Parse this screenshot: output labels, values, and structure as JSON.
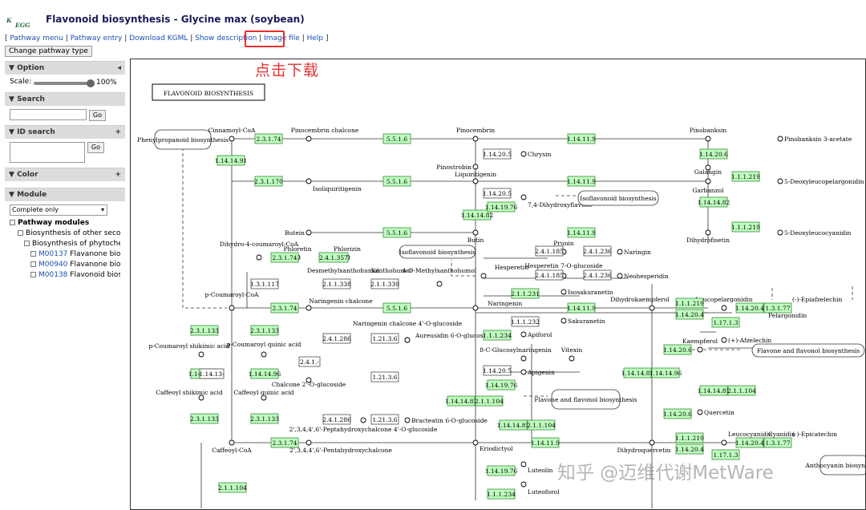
{
  "header": {
    "logo": "KEGG",
    "title": "Flavonoid biosynthesis - Glycine max (soybean)",
    "links": [
      "Pathway menu",
      "Pathway entry",
      "Download KGML",
      "Show description",
      "Image file",
      "Help"
    ],
    "change_type": "Change pathway type",
    "annotation": "点击下载",
    "highlight_color": "#e53030"
  },
  "sidebar": {
    "option": {
      "label": "Option",
      "scale_label": "Scale:",
      "scale_value": "100%",
      "scale_fraction": 1.0
    },
    "search": {
      "label": "Search",
      "go": "Go"
    },
    "id_search": {
      "label": "ID search",
      "go": "Go"
    },
    "color": {
      "label": "Color"
    },
    "module": {
      "label": "Module",
      "select": "Complete only",
      "tree": [
        "Pathway modules",
        "Biosynthesis of other secondary metabolites",
        "Biosynthesis of phytochemical compounds"
      ],
      "items": [
        {
          "id": "M00137",
          "name": "Flavanone biosynthesis"
        },
        {
          "id": "M00940",
          "name": "Flavanone biosynthesis"
        },
        {
          "id": "M00138",
          "name": "Flavonoid biosynthesis"
        }
      ]
    }
  },
  "map": {
    "title": "FLAVONOID BIOSYNTHESIS",
    "enzyme_fill": "#bfffbf",
    "enzyme_stroke": "#3a8a3a",
    "enzymes": [
      "2.3.1.74",
      "5.5.1.6",
      "1.14.11.9",
      "1.14.14.91",
      "2.3.1.170",
      "1.14.20.5",
      "1.14.19.76",
      "1.14.14.82",
      "1.14.20.6",
      "1.1.1.219",
      "2.3.1.133",
      "1.14.13-",
      "1.14.14.96",
      "1.14.14.81",
      "2.1.1.104",
      "2.4.1.185",
      "2.4.1.236",
      "2.1.1.231",
      "1.1.1.232",
      "1.1.1.234",
      "2.4.1.286",
      "1.21.3.6",
      "1.17.1.3",
      "1.3.1.77",
      "1.14.20.4",
      "2.1.1.338",
      "2.1.1.339",
      "1.3.1.117",
      "2.4.1.357",
      "2.4.1.-"
    ],
    "compounds": [
      "Cinnamoyl-CoA",
      "Pinocembrin chalcone",
      "Pinocembrin",
      "Pinobanksin",
      "Pinobanksin 3-acetate",
      "Chrysin",
      "Pinostrobin",
      "Galangin",
      "Liquiritigenin",
      "Isoliquiritigenin",
      "Garbanzol",
      "5-Deoxyleucopelargonidin",
      "7,4-Dihydroxyflavone",
      "Isoflavonoid biosynthesis",
      "Butein",
      "Butin",
      "Dihydrofisetin",
      "5-Deoxyleucocyanidin",
      "Dihydro-4-coumaroyl-CoA",
      "Phloretin",
      "Phlorizin",
      "Prunin",
      "Naringin",
      "Hesperetin",
      "Hesperetin 7-O-glucoside",
      "Neohesperidin",
      "Desmethylxanthohumol",
      "Xanthohumol",
      "4-O-Methylxanthohumol",
      "p-Coumaroyl-CoA",
      "Naringenin chalcone",
      "Naringenin",
      "Isosakuranetin",
      "Sakuranetin",
      "Apiforol",
      "Dihydrokaempferol",
      "Leucopelargonidin",
      "Pelargonidin",
      "(-)-Epiafzelechin",
      "(+)-Afzelechin",
      "Kaempferol",
      "Flavone and flavonol biosynthesis",
      "Naringenin chalcone 4'-O-glucoside",
      "Aureusidin 6-O-glucoside",
      "p-Coumaroyl shikimic acid",
      "p-Coumaroyl quinic acid",
      "Chalcone 2'-O-glucoside",
      "8-C-Glucosylnaringenin",
      "Vitexin",
      "Apigenin",
      "Caffeoyl shikimic acid",
      "Caffeoyl quinic acid",
      "2',3,4,4',6'-Peptahydroxychalcone 4'-O-glucoside",
      "Bracteatin 6-O-glucoside",
      "Caffeoyl-CoA",
      "2',3,4,4',6'-Pentahydroxychalcone",
      "Eriodictyol",
      "Luteolin",
      "Luteoforol",
      "Dihydroquercetin",
      "Leucocyanidin",
      "Cyanidin",
      "(-)-Epicatechin",
      "Anthocyanin biosynthesis",
      "Quercetin",
      "Phenylpropanoid biosynthesis"
    ]
  },
  "watermark": "知乎 @迈维代谢MetWare"
}
